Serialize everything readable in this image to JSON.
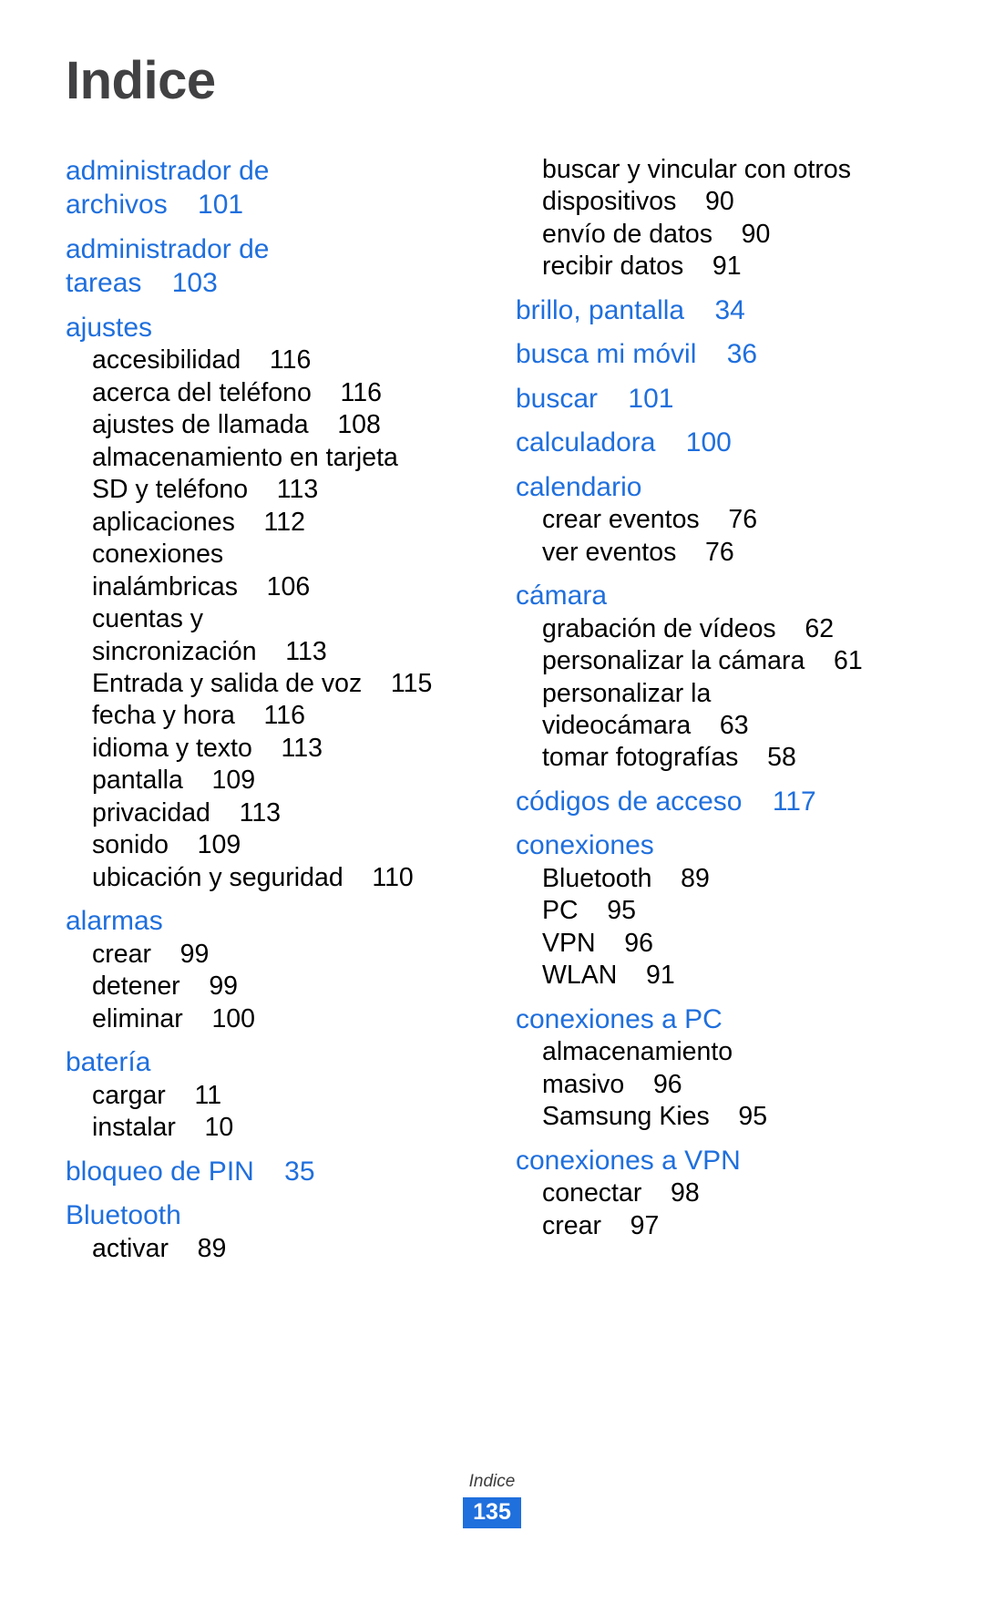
{
  "document": {
    "title": "Indice",
    "accent_color": "#1f6fdd",
    "title_color": "#414042"
  },
  "left_column": {
    "entries": [
      {
        "type": "head",
        "text": "administrador de\narchivos    101"
      },
      {
        "type": "head",
        "text": "administrador de\ntareas    103"
      },
      {
        "type": "head",
        "text": "ajustes"
      },
      {
        "type": "sub",
        "text": "accesibilidad    116"
      },
      {
        "type": "sub",
        "text": "acerca del teléfono    116"
      },
      {
        "type": "sub",
        "text": "ajustes de llamada    108"
      },
      {
        "type": "sub",
        "text": "almacenamiento en tarjeta\nSD y teléfono    113"
      },
      {
        "type": "sub",
        "text": "aplicaciones    112"
      },
      {
        "type": "sub",
        "text": "conexiones\ninalámbricas    106"
      },
      {
        "type": "sub",
        "text": "cuentas y\nsincronización    113"
      },
      {
        "type": "sub",
        "text": "Entrada y salida de voz    115"
      },
      {
        "type": "sub",
        "text": "fecha y hora    116"
      },
      {
        "type": "sub",
        "text": "idioma y texto    113"
      },
      {
        "type": "sub",
        "text": "pantalla    109"
      },
      {
        "type": "sub",
        "text": "privacidad    113"
      },
      {
        "type": "sub",
        "text": "sonido    109"
      },
      {
        "type": "sub",
        "text": "ubicación y seguridad    110"
      },
      {
        "type": "head",
        "text": "alarmas"
      },
      {
        "type": "sub",
        "text": "crear    99"
      },
      {
        "type": "sub",
        "text": "detener    99"
      },
      {
        "type": "sub",
        "text": "eliminar    100"
      },
      {
        "type": "head",
        "text": "batería"
      },
      {
        "type": "sub",
        "text": "cargar    11"
      },
      {
        "type": "sub",
        "text": "instalar    10"
      },
      {
        "type": "head",
        "text": "bloqueo de PIN    35"
      },
      {
        "type": "head",
        "text": "Bluetooth"
      },
      {
        "type": "sub",
        "text": "activar    89"
      }
    ]
  },
  "right_column": {
    "entries": [
      {
        "type": "sub",
        "text": "buscar y vincular con otros\ndispositivos    90"
      },
      {
        "type": "sub",
        "text": "envío de datos    90"
      },
      {
        "type": "sub",
        "text": "recibir datos    91"
      },
      {
        "type": "head",
        "text": "brillo, pantalla    34"
      },
      {
        "type": "head",
        "text": "busca mi móvil    36"
      },
      {
        "type": "head",
        "text": "buscar    101"
      },
      {
        "type": "head",
        "text": "calculadora    100"
      },
      {
        "type": "head",
        "text": "calendario"
      },
      {
        "type": "sub",
        "text": "crear eventos    76"
      },
      {
        "type": "sub",
        "text": "ver eventos    76"
      },
      {
        "type": "head",
        "text": "cámara"
      },
      {
        "type": "sub",
        "text": "grabación de vídeos    62"
      },
      {
        "type": "sub",
        "text": "personalizar la cámara    61"
      },
      {
        "type": "sub",
        "text": "personalizar la\nvideocámara    63"
      },
      {
        "type": "sub",
        "text": "tomar fotografías    58"
      },
      {
        "type": "head",
        "text": "códigos de acceso    117"
      },
      {
        "type": "head",
        "text": "conexiones"
      },
      {
        "type": "sub",
        "text": "Bluetooth    89"
      },
      {
        "type": "sub",
        "text": "PC    95"
      },
      {
        "type": "sub",
        "text": "VPN    96"
      },
      {
        "type": "sub",
        "text": "WLAN    91"
      },
      {
        "type": "head",
        "text": "conexiones a PC"
      },
      {
        "type": "sub",
        "text": "almacenamiento\nmasivo    96"
      },
      {
        "type": "sub",
        "text": "Samsung Kies    95"
      },
      {
        "type": "head",
        "text": "conexiones a VPN"
      },
      {
        "type": "sub",
        "text": "conectar    98"
      },
      {
        "type": "sub",
        "text": "crear    97"
      }
    ]
  },
  "footer": {
    "label": "Indice",
    "page_number": "135"
  }
}
